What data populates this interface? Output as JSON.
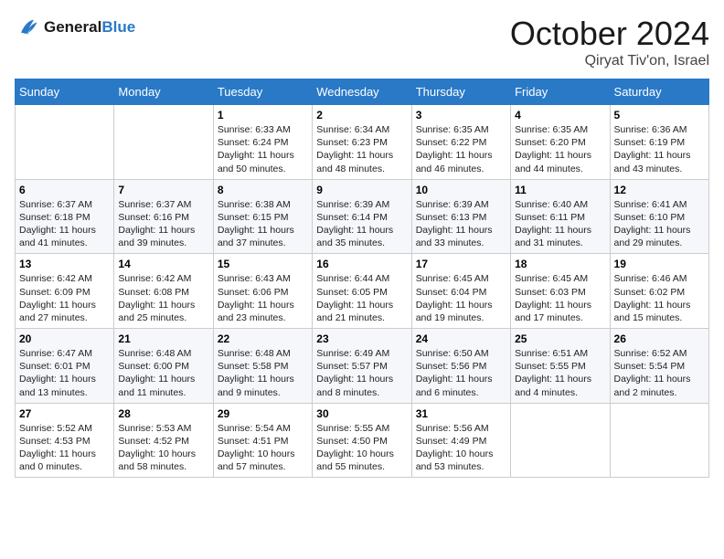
{
  "header": {
    "logo_line1": "General",
    "logo_line2": "Blue",
    "month": "October 2024",
    "location": "Qiryat Tiv'on, Israel"
  },
  "days_of_week": [
    "Sunday",
    "Monday",
    "Tuesday",
    "Wednesday",
    "Thursday",
    "Friday",
    "Saturday"
  ],
  "weeks": [
    [
      {
        "day": "",
        "info": ""
      },
      {
        "day": "",
        "info": ""
      },
      {
        "day": "1",
        "info": "Sunrise: 6:33 AM\nSunset: 6:24 PM\nDaylight: 11 hours and 50 minutes."
      },
      {
        "day": "2",
        "info": "Sunrise: 6:34 AM\nSunset: 6:23 PM\nDaylight: 11 hours and 48 minutes."
      },
      {
        "day": "3",
        "info": "Sunrise: 6:35 AM\nSunset: 6:22 PM\nDaylight: 11 hours and 46 minutes."
      },
      {
        "day": "4",
        "info": "Sunrise: 6:35 AM\nSunset: 6:20 PM\nDaylight: 11 hours and 44 minutes."
      },
      {
        "day": "5",
        "info": "Sunrise: 6:36 AM\nSunset: 6:19 PM\nDaylight: 11 hours and 43 minutes."
      }
    ],
    [
      {
        "day": "6",
        "info": "Sunrise: 6:37 AM\nSunset: 6:18 PM\nDaylight: 11 hours and 41 minutes."
      },
      {
        "day": "7",
        "info": "Sunrise: 6:37 AM\nSunset: 6:16 PM\nDaylight: 11 hours and 39 minutes."
      },
      {
        "day": "8",
        "info": "Sunrise: 6:38 AM\nSunset: 6:15 PM\nDaylight: 11 hours and 37 minutes."
      },
      {
        "day": "9",
        "info": "Sunrise: 6:39 AM\nSunset: 6:14 PM\nDaylight: 11 hours and 35 minutes."
      },
      {
        "day": "10",
        "info": "Sunrise: 6:39 AM\nSunset: 6:13 PM\nDaylight: 11 hours and 33 minutes."
      },
      {
        "day": "11",
        "info": "Sunrise: 6:40 AM\nSunset: 6:11 PM\nDaylight: 11 hours and 31 minutes."
      },
      {
        "day": "12",
        "info": "Sunrise: 6:41 AM\nSunset: 6:10 PM\nDaylight: 11 hours and 29 minutes."
      }
    ],
    [
      {
        "day": "13",
        "info": "Sunrise: 6:42 AM\nSunset: 6:09 PM\nDaylight: 11 hours and 27 minutes."
      },
      {
        "day": "14",
        "info": "Sunrise: 6:42 AM\nSunset: 6:08 PM\nDaylight: 11 hours and 25 minutes."
      },
      {
        "day": "15",
        "info": "Sunrise: 6:43 AM\nSunset: 6:06 PM\nDaylight: 11 hours and 23 minutes."
      },
      {
        "day": "16",
        "info": "Sunrise: 6:44 AM\nSunset: 6:05 PM\nDaylight: 11 hours and 21 minutes."
      },
      {
        "day": "17",
        "info": "Sunrise: 6:45 AM\nSunset: 6:04 PM\nDaylight: 11 hours and 19 minutes."
      },
      {
        "day": "18",
        "info": "Sunrise: 6:45 AM\nSunset: 6:03 PM\nDaylight: 11 hours and 17 minutes."
      },
      {
        "day": "19",
        "info": "Sunrise: 6:46 AM\nSunset: 6:02 PM\nDaylight: 11 hours and 15 minutes."
      }
    ],
    [
      {
        "day": "20",
        "info": "Sunrise: 6:47 AM\nSunset: 6:01 PM\nDaylight: 11 hours and 13 minutes."
      },
      {
        "day": "21",
        "info": "Sunrise: 6:48 AM\nSunset: 6:00 PM\nDaylight: 11 hours and 11 minutes."
      },
      {
        "day": "22",
        "info": "Sunrise: 6:48 AM\nSunset: 5:58 PM\nDaylight: 11 hours and 9 minutes."
      },
      {
        "day": "23",
        "info": "Sunrise: 6:49 AM\nSunset: 5:57 PM\nDaylight: 11 hours and 8 minutes."
      },
      {
        "day": "24",
        "info": "Sunrise: 6:50 AM\nSunset: 5:56 PM\nDaylight: 11 hours and 6 minutes."
      },
      {
        "day": "25",
        "info": "Sunrise: 6:51 AM\nSunset: 5:55 PM\nDaylight: 11 hours and 4 minutes."
      },
      {
        "day": "26",
        "info": "Sunrise: 6:52 AM\nSunset: 5:54 PM\nDaylight: 11 hours and 2 minutes."
      }
    ],
    [
      {
        "day": "27",
        "info": "Sunrise: 5:52 AM\nSunset: 4:53 PM\nDaylight: 11 hours and 0 minutes."
      },
      {
        "day": "28",
        "info": "Sunrise: 5:53 AM\nSunset: 4:52 PM\nDaylight: 10 hours and 58 minutes."
      },
      {
        "day": "29",
        "info": "Sunrise: 5:54 AM\nSunset: 4:51 PM\nDaylight: 10 hours and 57 minutes."
      },
      {
        "day": "30",
        "info": "Sunrise: 5:55 AM\nSunset: 4:50 PM\nDaylight: 10 hours and 55 minutes."
      },
      {
        "day": "31",
        "info": "Sunrise: 5:56 AM\nSunset: 4:49 PM\nDaylight: 10 hours and 53 minutes."
      },
      {
        "day": "",
        "info": ""
      },
      {
        "day": "",
        "info": ""
      }
    ]
  ]
}
